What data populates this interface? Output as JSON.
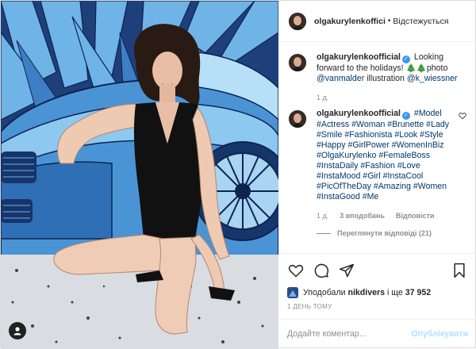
{
  "post": {
    "username": "olgakurylenkoofficial",
    "username_header": "olgakurylenkoffici",
    "follow_status": "Відстежується",
    "caption": {
      "text": "Looking forward to the holidays! 🎄🎄photo",
      "mentions": [
        "@vanmalder",
        "illustration",
        "@k_wiessner"
      ],
      "time": "1 д."
    },
    "comment": {
      "hashtags_html_text": "#Model #Actress #Woman #Brunette #Lady #Smile #Fashionista #Look #Style #Happy #GirlPower #WomenInBiz #OlgaKurylenko #FemaleBoss #InstaDaily #Fashion #Love #InstaMood #Girl #InstaCool #PicOfTheDay #Amazing #Women #InstaGood #Me",
      "time": "1 д.",
      "likes": "3 вподобань",
      "reply": "Відповісти",
      "view_replies": "Переглянути відповіді (21)"
    },
    "likes_line": {
      "prefix": "Уподобали",
      "user": "nikdivers",
      "suffix": "і ще",
      "count": "37 952"
    },
    "posted_ago": "1 ДЕНЬ ТОМУ",
    "comment_input": {
      "placeholder": "Додайте коментар..."
    },
    "publish_label": "Опублікувати"
  },
  "colors": {
    "link": "#00376b",
    "verified": "#3897f0",
    "muted": "#8e8e8e",
    "publish_disabled": "#b2dffc"
  }
}
